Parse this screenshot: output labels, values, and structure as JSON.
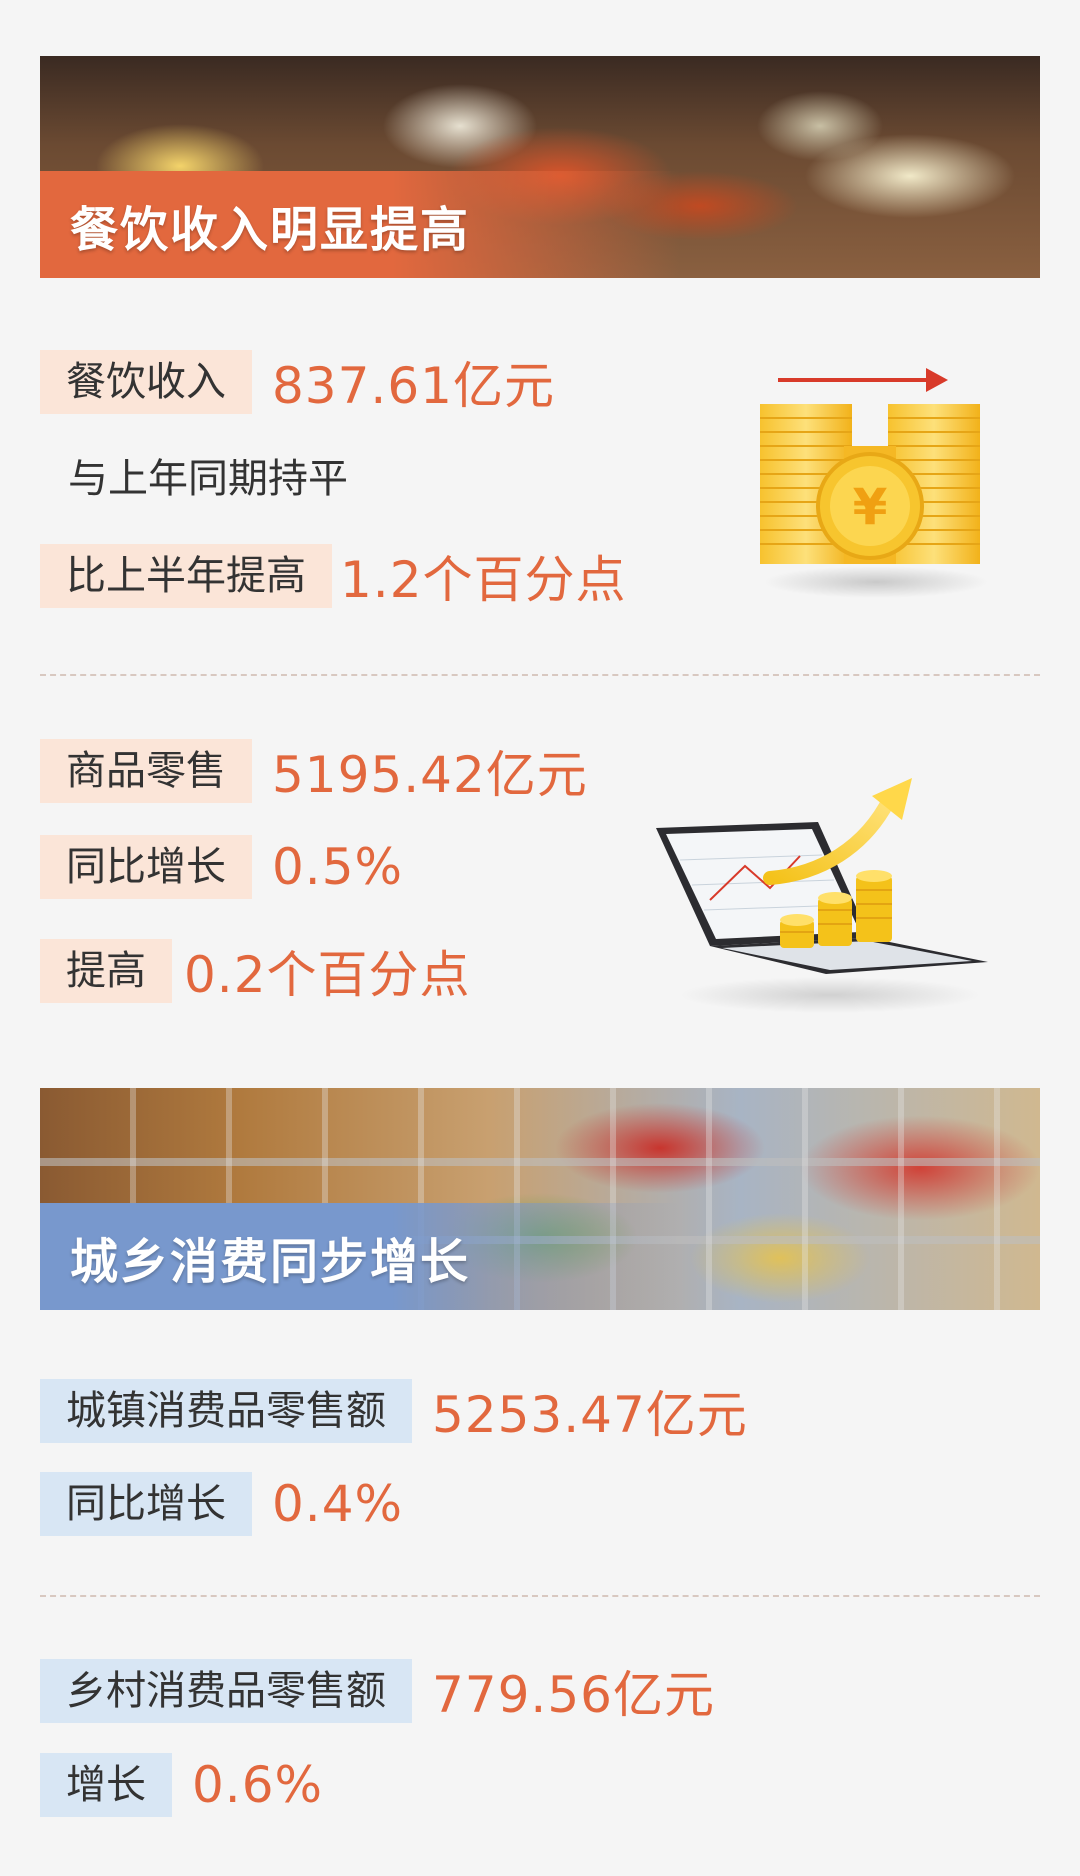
{
  "section1": {
    "banner_title": "餐饮收入明显提高",
    "rows": [
      {
        "label": "餐饮收入",
        "value": "837.61亿元"
      },
      {
        "text": "与上年同期持平"
      },
      {
        "label": "比上半年提高",
        "value": "1.2个百分点"
      }
    ]
  },
  "section2": {
    "rows": [
      {
        "label": "商品零售",
        "value": "5195.42亿元"
      },
      {
        "label": "同比增长",
        "value": "0.5%"
      },
      {
        "label": "提高",
        "value": "0.2个百分点"
      }
    ]
  },
  "section3": {
    "banner_title": "城乡消费同步增长",
    "urban": [
      {
        "label": "城镇消费品零售额",
        "value": "5253.47亿元"
      },
      {
        "label": "同比增长",
        "value": "0.4%"
      }
    ],
    "rural": [
      {
        "label": "乡村消费品零售额",
        "value": "779.56亿元"
      },
      {
        "label": "增长",
        "value": "0.6%"
      }
    ]
  },
  "illustrations": {
    "coins": "yuan-coin-stack-icon",
    "laptop": "laptop-growth-chart-icon"
  },
  "colors": {
    "accent": "#e2683e",
    "chip_orange": "#fbe5d8",
    "chip_blue": "#d8e6f4",
    "banner_orange": "#e2683e",
    "banner_blue": "#7898cd"
  }
}
